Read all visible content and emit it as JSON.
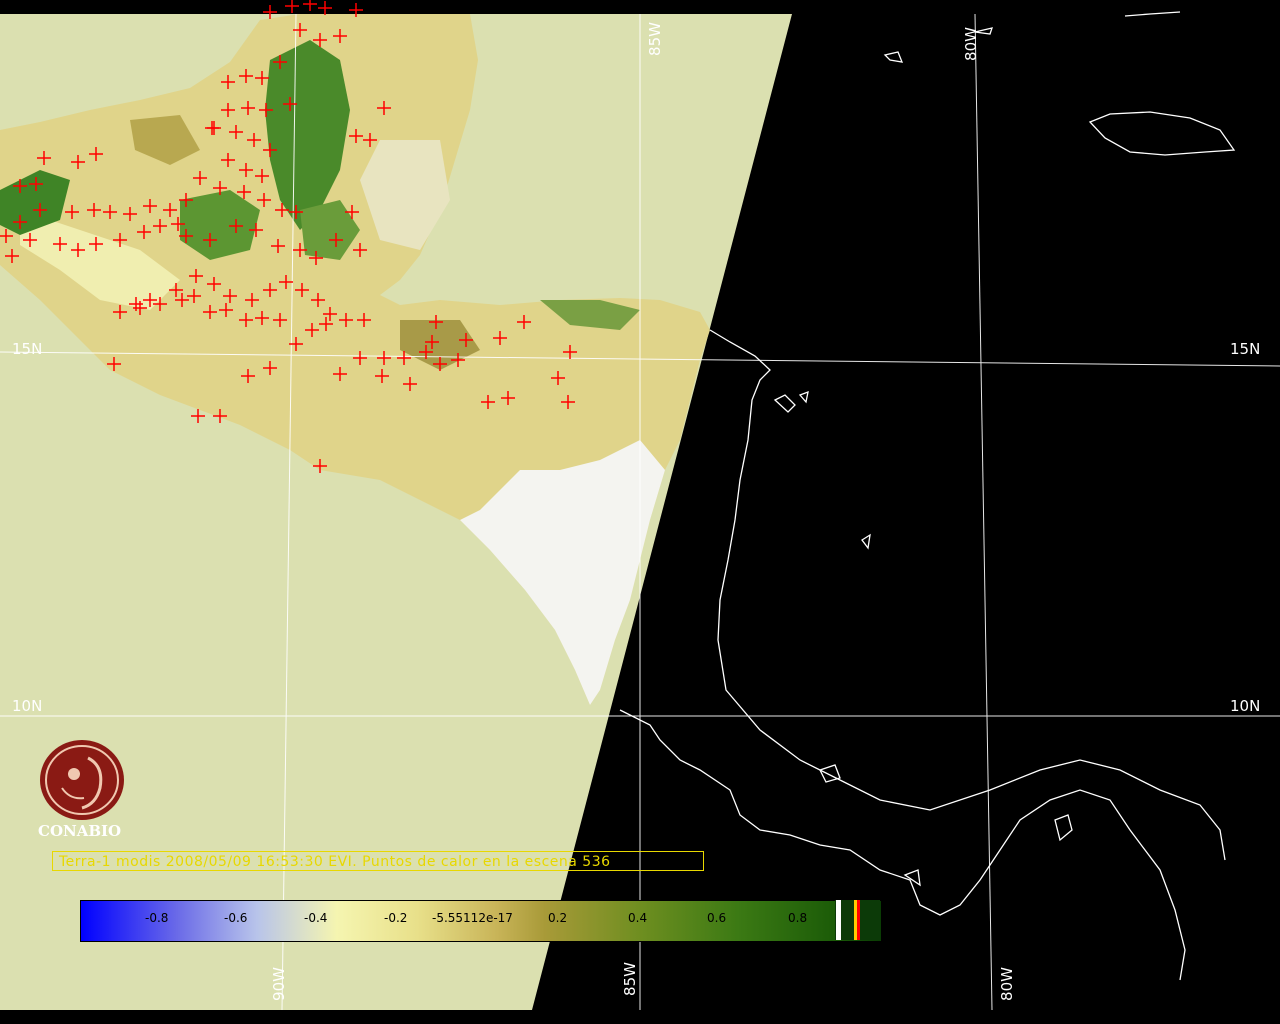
{
  "lat_labels": {
    "lat15_left": "15N",
    "lat15_right": "15N",
    "lat10_left": "10N",
    "lat10_right": "10N"
  },
  "lon_labels": {
    "lon85_top": "85W",
    "lon80_top": "80W",
    "lon90_bottom": "90W",
    "lon85_bottom": "85W",
    "lon80_bottom": "80W"
  },
  "logo": {
    "name": "CONABIO"
  },
  "caption": "Terra-1 modis 2008/05/09 16:53:30 EVI. Puntos de calor en la escena 536",
  "colorbar": {
    "ticks": [
      "-0.8",
      "-0.6",
      "-0.4",
      "-0.2",
      "-5.55112e-17",
      "0.2",
      "0.4",
      "0.6",
      "0.8"
    ],
    "colors": {
      "low": "#0000ff",
      "mid": "#f5f5b0",
      "high": "#0a3c04",
      "hotspot": "#ff0000",
      "background_swath": "#dbe0b0"
    }
  }
}
